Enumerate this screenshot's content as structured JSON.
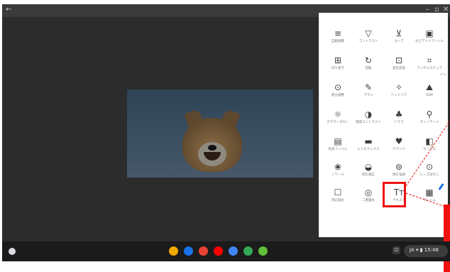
{
  "window": {
    "controls": {
      "back": "←",
      "minimize": "–",
      "maximize": "▫",
      "close": "✕"
    }
  },
  "toolbar": {
    "tools": [
      {
        "icon": "≡",
        "label": "自動調整",
        "icon_name": "adjust-icon"
      },
      {
        "icon": "▽",
        "label": "コントラスト",
        "icon_name": "contrast-icon"
      },
      {
        "icon": "⊻",
        "label": "カーブ",
        "icon_name": "curves-icon"
      },
      {
        "icon": "▣",
        "label": "セピアトリアージュ",
        "icon_name": "vignette-icon"
      },
      {
        "icon": "⊞",
        "label": "切り抜き",
        "icon_name": "crop-icon"
      },
      {
        "icon": "↻",
        "label": "回転",
        "icon_name": "rotate-icon"
      },
      {
        "icon": "⊡",
        "label": "遠近変換",
        "icon_name": "perspective-icon"
      },
      {
        "icon": "⌗",
        "label": "アングルスナップ",
        "icon_name": "expand-icon"
      },
      {
        "icon": "⊙",
        "label": "部分調整",
        "icon_name": "selective-icon"
      },
      {
        "icon": "✎",
        "label": "ブラシ",
        "icon_name": "brush-icon"
      },
      {
        "icon": "✧",
        "label": "ヘッドリア",
        "icon_name": "healing-icon"
      },
      {
        "icon": "⛰",
        "label": "HDR",
        "icon_name": "hdr-icon"
      },
      {
        "icon": "☼",
        "label": "グラマーグロー",
        "icon_name": "glow-icon"
      },
      {
        "icon": "◑",
        "label": "階調コントラスト",
        "icon_name": "tonal-contrast-icon"
      },
      {
        "icon": "♣",
        "label": "ドラマ",
        "icon_name": "drama-icon"
      },
      {
        "icon": "⚲",
        "label": "ヴィンテージ",
        "icon_name": "vintage-icon"
      },
      {
        "icon": "▤",
        "label": "粒状フィルム",
        "icon_name": "film-icon"
      },
      {
        "icon": "▬",
        "label": "レトロラックス",
        "icon_name": "retrolux-icon"
      },
      {
        "icon": "♥",
        "label": "グランジ",
        "icon_name": "grunge-icon"
      },
      {
        "icon": "◧",
        "label": "モノクロ",
        "icon_name": "monochrome-icon"
      },
      {
        "icon": "❀",
        "label": "ノワール",
        "icon_name": "noir-icon"
      },
      {
        "icon": "◒",
        "label": "顔を補正",
        "icon_name": "face-icon"
      },
      {
        "icon": "⊚",
        "label": "顔を強調",
        "icon_name": "focus-icon"
      },
      {
        "icon": "⊙",
        "label": "レンズぼかし",
        "icon_name": "lens-blur-icon"
      },
      {
        "icon": "☐",
        "label": "周辺減光",
        "icon_name": "frames-icon"
      },
      {
        "icon": "◎",
        "label": "二重露光",
        "icon_name": "double-exposure-icon"
      },
      {
        "icon": "Tт",
        "label": "テキスト",
        "icon_name": "text-icon"
      },
      {
        "icon": "▦",
        "label": "フレーム",
        "icon_name": "frame-icon"
      }
    ],
    "collapse_icon": "︿",
    "pen_icon": "edit-pencil-icon"
  },
  "shelf": {
    "apps": [
      {
        "name": "chrome-icon",
        "color": "#f2a900"
      },
      {
        "name": "files-icon",
        "color": "#1a73e8"
      },
      {
        "name": "gmail-icon",
        "color": "#ea4335"
      },
      {
        "name": "youtube-icon",
        "color": "#ff0000"
      },
      {
        "name": "docs-icon",
        "color": "#4285f4"
      },
      {
        "name": "play-icon",
        "color": "#34a853"
      },
      {
        "name": "snapseed-icon",
        "color": "#5fbf3a"
      }
    ],
    "pip_label": "⊡",
    "status_text": "JA ▾ ▮ 15:48"
  },
  "colors": {
    "highlight": "#ee1111",
    "panel_background": "#ffffff",
    "desktop": "#2b2b2b"
  }
}
